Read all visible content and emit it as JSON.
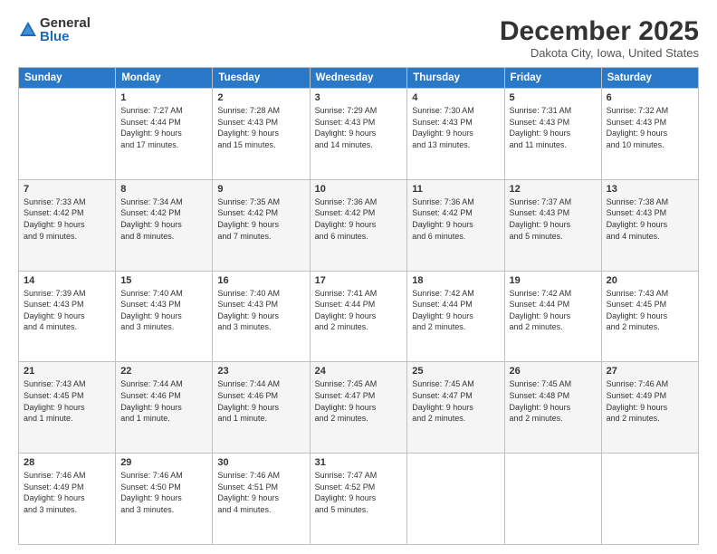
{
  "logo": {
    "general": "General",
    "blue": "Blue"
  },
  "title": "December 2025",
  "location": "Dakota City, Iowa, United States",
  "days_header": [
    "Sunday",
    "Monday",
    "Tuesday",
    "Wednesday",
    "Thursday",
    "Friday",
    "Saturday"
  ],
  "weeks": [
    [
      {
        "day": "",
        "info": ""
      },
      {
        "day": "1",
        "info": "Sunrise: 7:27 AM\nSunset: 4:44 PM\nDaylight: 9 hours\nand 17 minutes."
      },
      {
        "day": "2",
        "info": "Sunrise: 7:28 AM\nSunset: 4:43 PM\nDaylight: 9 hours\nand 15 minutes."
      },
      {
        "day": "3",
        "info": "Sunrise: 7:29 AM\nSunset: 4:43 PM\nDaylight: 9 hours\nand 14 minutes."
      },
      {
        "day": "4",
        "info": "Sunrise: 7:30 AM\nSunset: 4:43 PM\nDaylight: 9 hours\nand 13 minutes."
      },
      {
        "day": "5",
        "info": "Sunrise: 7:31 AM\nSunset: 4:43 PM\nDaylight: 9 hours\nand 11 minutes."
      },
      {
        "day": "6",
        "info": "Sunrise: 7:32 AM\nSunset: 4:43 PM\nDaylight: 9 hours\nand 10 minutes."
      }
    ],
    [
      {
        "day": "7",
        "info": "Sunrise: 7:33 AM\nSunset: 4:42 PM\nDaylight: 9 hours\nand 9 minutes."
      },
      {
        "day": "8",
        "info": "Sunrise: 7:34 AM\nSunset: 4:42 PM\nDaylight: 9 hours\nand 8 minutes."
      },
      {
        "day": "9",
        "info": "Sunrise: 7:35 AM\nSunset: 4:42 PM\nDaylight: 9 hours\nand 7 minutes."
      },
      {
        "day": "10",
        "info": "Sunrise: 7:36 AM\nSunset: 4:42 PM\nDaylight: 9 hours\nand 6 minutes."
      },
      {
        "day": "11",
        "info": "Sunrise: 7:36 AM\nSunset: 4:42 PM\nDaylight: 9 hours\nand 6 minutes."
      },
      {
        "day": "12",
        "info": "Sunrise: 7:37 AM\nSunset: 4:43 PM\nDaylight: 9 hours\nand 5 minutes."
      },
      {
        "day": "13",
        "info": "Sunrise: 7:38 AM\nSunset: 4:43 PM\nDaylight: 9 hours\nand 4 minutes."
      }
    ],
    [
      {
        "day": "14",
        "info": "Sunrise: 7:39 AM\nSunset: 4:43 PM\nDaylight: 9 hours\nand 4 minutes."
      },
      {
        "day": "15",
        "info": "Sunrise: 7:40 AM\nSunset: 4:43 PM\nDaylight: 9 hours\nand 3 minutes."
      },
      {
        "day": "16",
        "info": "Sunrise: 7:40 AM\nSunset: 4:43 PM\nDaylight: 9 hours\nand 3 minutes."
      },
      {
        "day": "17",
        "info": "Sunrise: 7:41 AM\nSunset: 4:44 PM\nDaylight: 9 hours\nand 2 minutes."
      },
      {
        "day": "18",
        "info": "Sunrise: 7:42 AM\nSunset: 4:44 PM\nDaylight: 9 hours\nand 2 minutes."
      },
      {
        "day": "19",
        "info": "Sunrise: 7:42 AM\nSunset: 4:44 PM\nDaylight: 9 hours\nand 2 minutes."
      },
      {
        "day": "20",
        "info": "Sunrise: 7:43 AM\nSunset: 4:45 PM\nDaylight: 9 hours\nand 2 minutes."
      }
    ],
    [
      {
        "day": "21",
        "info": "Sunrise: 7:43 AM\nSunset: 4:45 PM\nDaylight: 9 hours\nand 1 minute."
      },
      {
        "day": "22",
        "info": "Sunrise: 7:44 AM\nSunset: 4:46 PM\nDaylight: 9 hours\nand 1 minute."
      },
      {
        "day": "23",
        "info": "Sunrise: 7:44 AM\nSunset: 4:46 PM\nDaylight: 9 hours\nand 1 minute."
      },
      {
        "day": "24",
        "info": "Sunrise: 7:45 AM\nSunset: 4:47 PM\nDaylight: 9 hours\nand 2 minutes."
      },
      {
        "day": "25",
        "info": "Sunrise: 7:45 AM\nSunset: 4:47 PM\nDaylight: 9 hours\nand 2 minutes."
      },
      {
        "day": "26",
        "info": "Sunrise: 7:45 AM\nSunset: 4:48 PM\nDaylight: 9 hours\nand 2 minutes."
      },
      {
        "day": "27",
        "info": "Sunrise: 7:46 AM\nSunset: 4:49 PM\nDaylight: 9 hours\nand 2 minutes."
      }
    ],
    [
      {
        "day": "28",
        "info": "Sunrise: 7:46 AM\nSunset: 4:49 PM\nDaylight: 9 hours\nand 3 minutes."
      },
      {
        "day": "29",
        "info": "Sunrise: 7:46 AM\nSunset: 4:50 PM\nDaylight: 9 hours\nand 3 minutes."
      },
      {
        "day": "30",
        "info": "Sunrise: 7:46 AM\nSunset: 4:51 PM\nDaylight: 9 hours\nand 4 minutes."
      },
      {
        "day": "31",
        "info": "Sunrise: 7:47 AM\nSunset: 4:52 PM\nDaylight: 9 hours\nand 5 minutes."
      },
      {
        "day": "",
        "info": ""
      },
      {
        "day": "",
        "info": ""
      },
      {
        "day": "",
        "info": ""
      }
    ]
  ]
}
